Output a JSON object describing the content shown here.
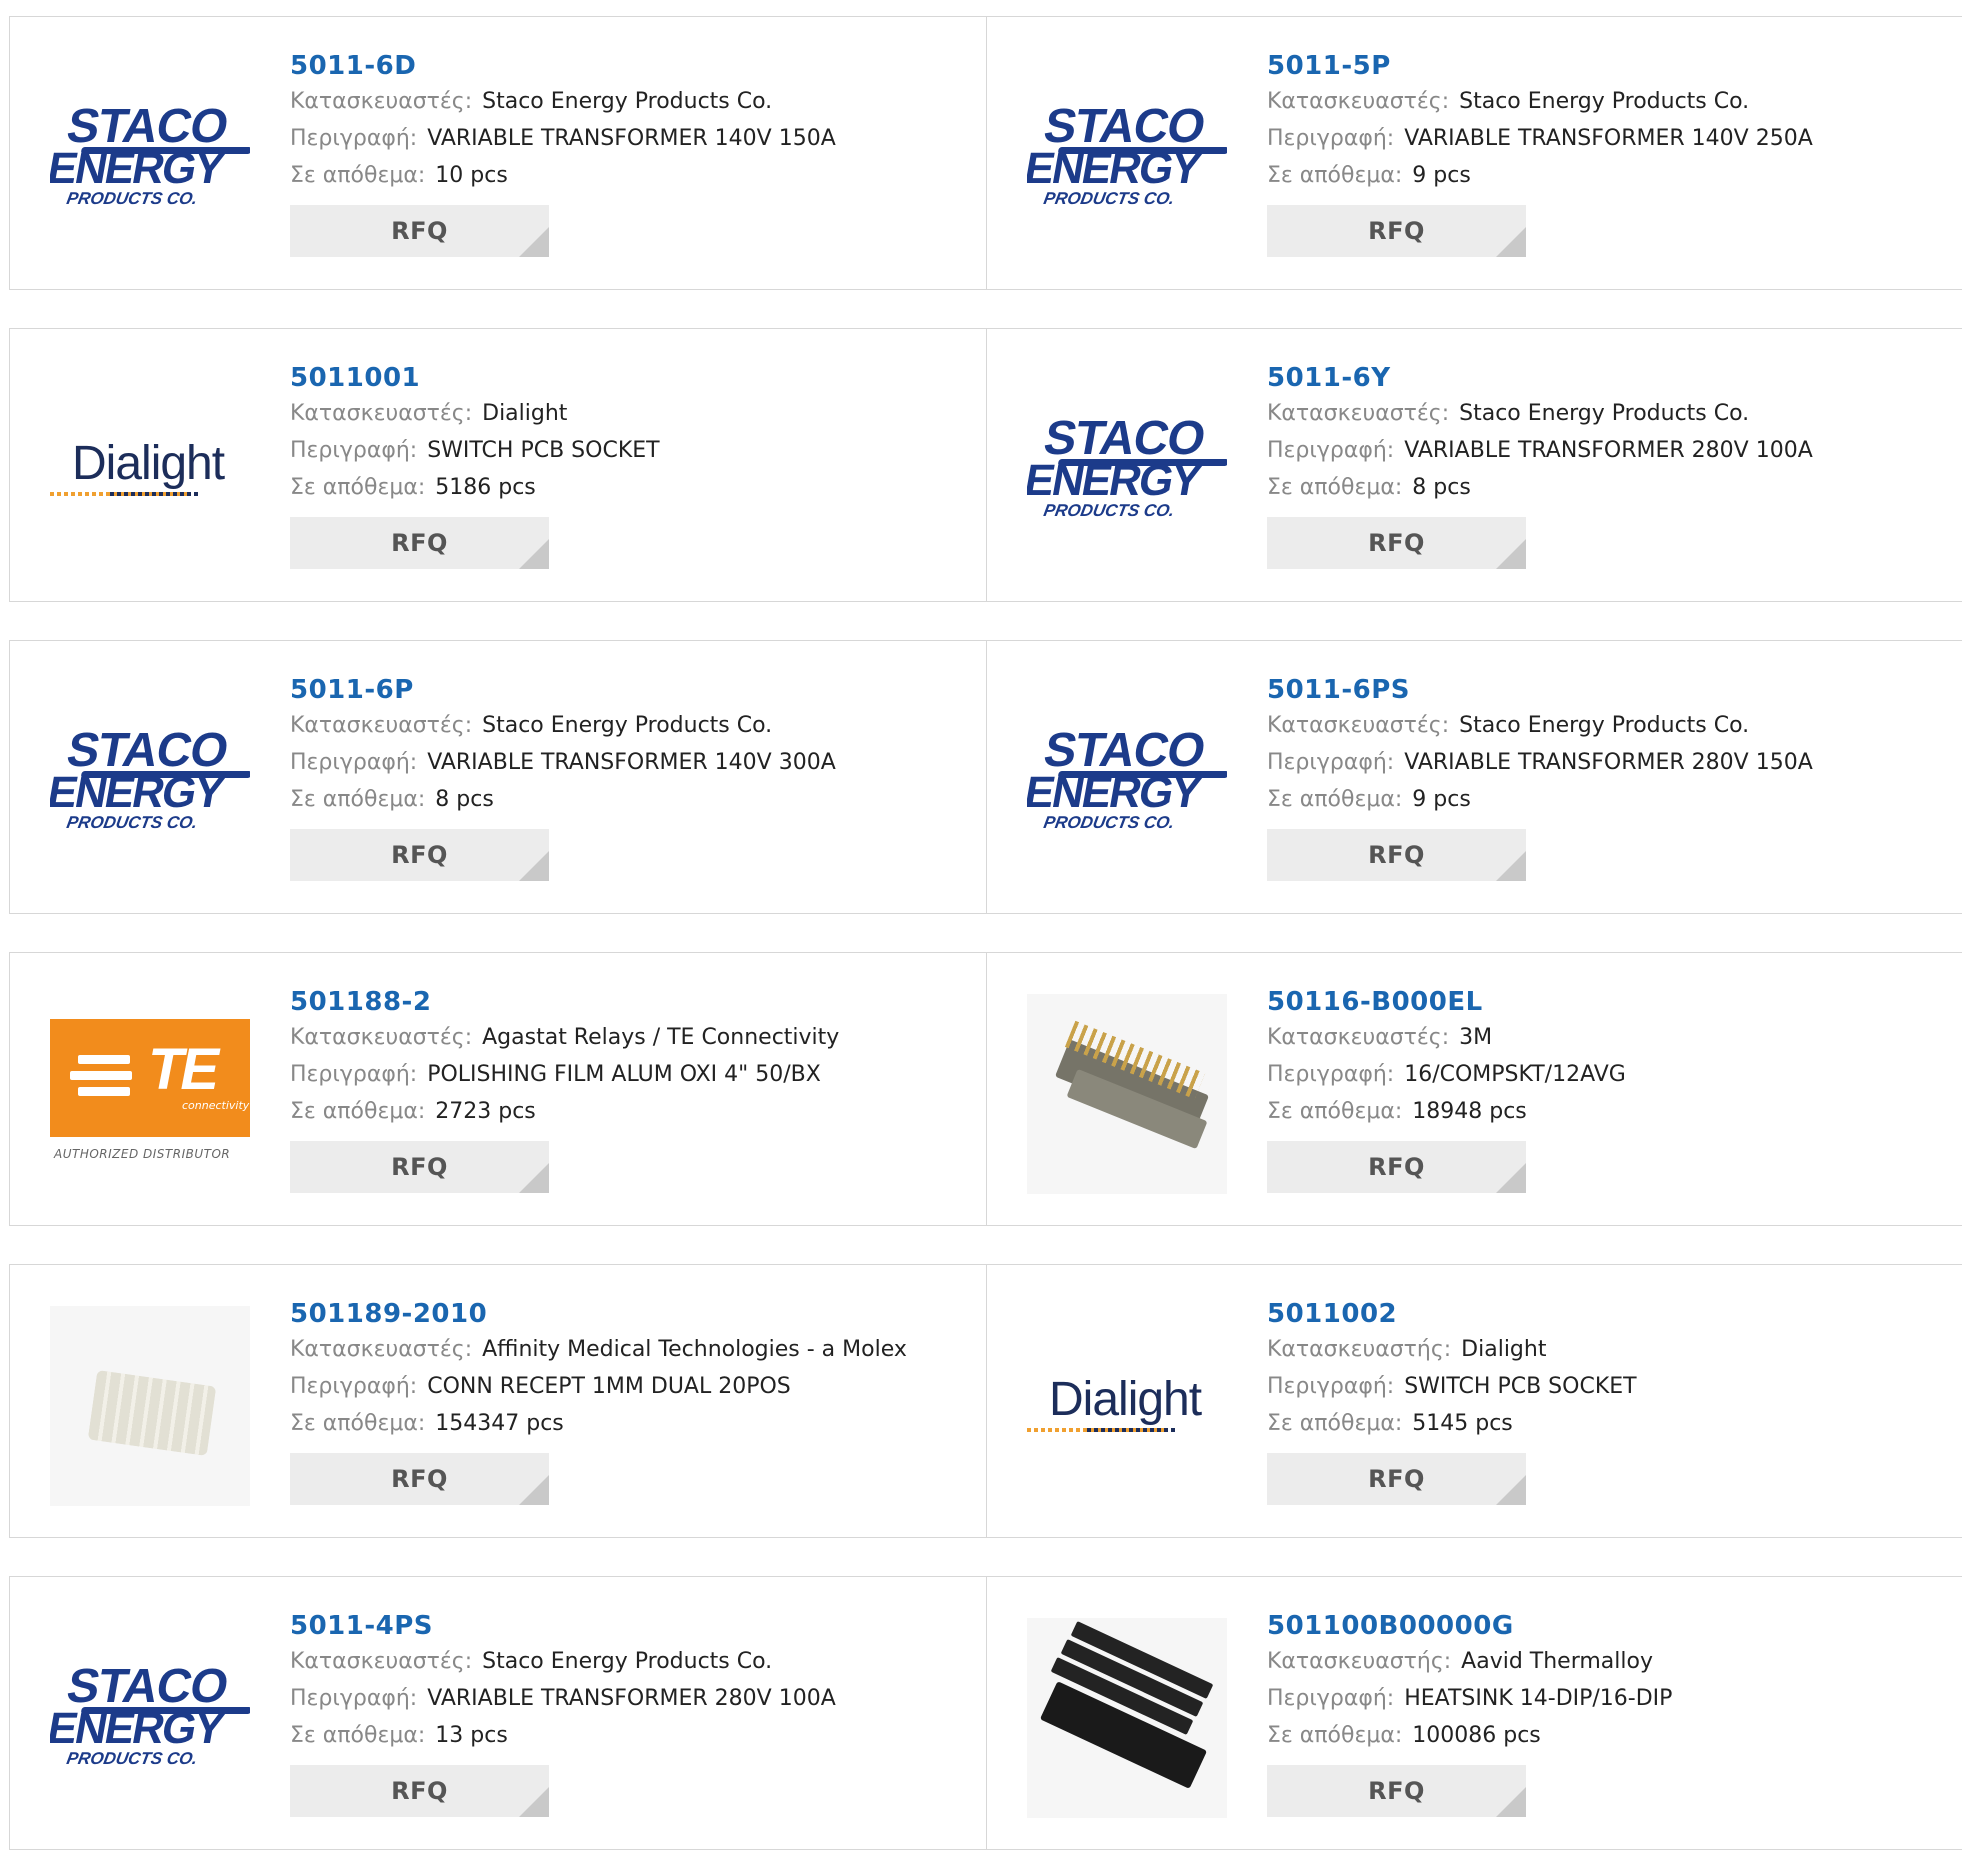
{
  "labels": {
    "manufacturer": "Κατασκευαστές:",
    "manufacturer_singular": "Κατασκευαστής:",
    "description": "Περιγραφή:",
    "stock": "Σε απόθεμα:",
    "rfq": "RFQ"
  },
  "logos": {
    "staco": {
      "line1": "STACO",
      "line2": "ENERGY",
      "line3": "PRODUCTS CO."
    },
    "dialight": {
      "word": "Dialight"
    },
    "te": {
      "word": "TE",
      "sub": "connectivity",
      "auth": "AUTHORIZED DISTRIBUTOR"
    }
  },
  "products": [
    {
      "part": "5011-6D",
      "manufacturer": "Staco Energy Products Co.",
      "description": "VARIABLE TRANSFORMER 140V 150A",
      "stock": "10 pcs",
      "logo": "staco"
    },
    {
      "part": "5011-5P",
      "manufacturer": "Staco Energy Products Co.",
      "description": "VARIABLE TRANSFORMER 140V 250A",
      "stock": "9 pcs",
      "logo": "staco"
    },
    {
      "part": "5011001",
      "manufacturer": "Dialight",
      "description": "SWITCH PCB SOCKET",
      "stock": "5186 pcs",
      "logo": "dialight"
    },
    {
      "part": "5011-6Y",
      "manufacturer": "Staco Energy Products Co.",
      "description": "VARIABLE TRANSFORMER 280V 100A",
      "stock": "8 pcs",
      "logo": "staco"
    },
    {
      "part": "5011-6P",
      "manufacturer": "Staco Energy Products Co.",
      "description": "VARIABLE TRANSFORMER 140V 300A",
      "stock": "8 pcs",
      "logo": "staco"
    },
    {
      "part": "5011-6PS",
      "manufacturer": "Staco Energy Products Co.",
      "description": "VARIABLE TRANSFORMER 280V 150A",
      "stock": "9 pcs",
      "logo": "staco"
    },
    {
      "part": "501188-2",
      "manufacturer": "Agastat Relays / TE Connectivity",
      "description": "POLISHING FILM ALUM OXI 4\" 50/BX",
      "stock": "2723 pcs",
      "logo": "te"
    },
    {
      "part": "50116-B000EL",
      "manufacturer": "3M",
      "description": "16/COMPSKT/12AVG",
      "stock": "18948 pcs",
      "logo": "connector-3m-photo"
    },
    {
      "part": "501189-2010",
      "manufacturer": "Affinity Medical Technologies - a Molex",
      "description": "CONN RECEPT 1MM DUAL 20POS",
      "stock": "154347 pcs",
      "logo": "molex-connector-photo"
    },
    {
      "part": "5011002",
      "manufacturer": "Dialight",
      "description": "SWITCH PCB SOCKET",
      "stock": "5145 pcs",
      "logo": "dialight"
    },
    {
      "part": "5011-4PS",
      "manufacturer": "Staco Energy Products Co.",
      "description": "VARIABLE TRANSFORMER 280V 100A",
      "stock": "13 pcs",
      "logo": "staco"
    },
    {
      "part": "501100B00000G",
      "manufacturer": "Aavid Thermalloy",
      "description": "HEATSINK 14-DIP/16-DIP",
      "stock": "100086 pcs",
      "logo": "heatsink-photo"
    }
  ]
}
